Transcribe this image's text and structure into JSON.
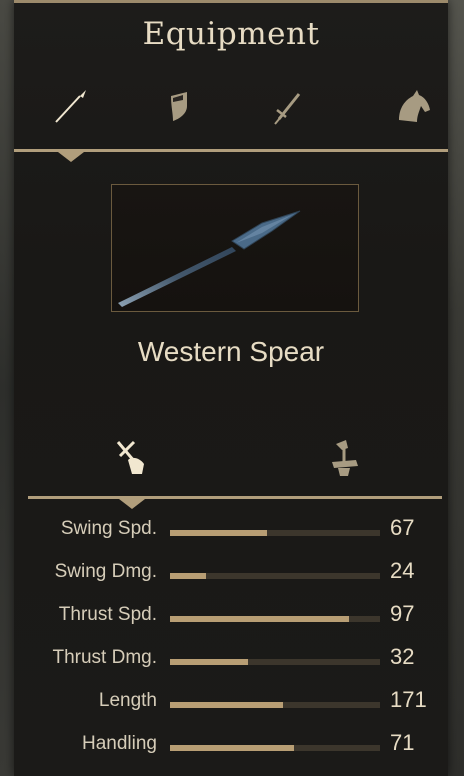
{
  "panel": {
    "title": "Equipment"
  },
  "tabs": [
    {
      "icon": "spear-icon",
      "selected": true
    },
    {
      "icon": "shield-icon",
      "selected": false
    },
    {
      "icon": "sword-icon",
      "selected": false
    },
    {
      "icon": "horse-icon",
      "selected": false
    }
  ],
  "weapon": {
    "name": "Western Spear"
  },
  "modes": [
    {
      "icon": "swing-hand-icon",
      "selected": true
    },
    {
      "icon": "thrust-icon",
      "selected": false
    }
  ],
  "stats": [
    {
      "label": "Swing Spd.",
      "value": "67",
      "fill": 0.46
    },
    {
      "label": "Swing Dmg.",
      "value": "24",
      "fill": 0.17
    },
    {
      "label": "Thrust Spd.",
      "value": "97",
      "fill": 0.85
    },
    {
      "label": "Thrust Dmg.",
      "value": "32",
      "fill": 0.37
    },
    {
      "label": "Length",
      "value": "171",
      "fill": 0.54
    },
    {
      "label": "Handling",
      "value": "71",
      "fill": 0.59
    }
  ],
  "colors": {
    "accent": "#b19e7c",
    "bar_fill": "#b89e74",
    "bar_track": "#3c362c",
    "text": "#e7dcc4"
  }
}
